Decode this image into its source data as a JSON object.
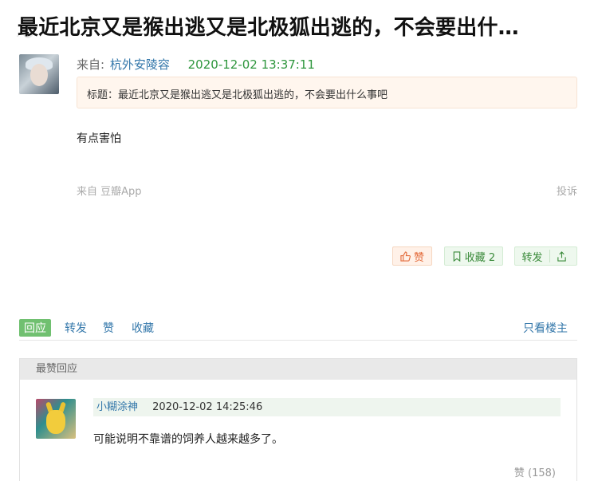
{
  "post": {
    "title": "最近北京又是猴出逃又是北极狐出逃的，不会要出什…",
    "from_label": "来自:",
    "author": "杭外安陵容",
    "timestamp": "2020-12-02 13:37:11",
    "quote": "标题：最近北京又是猴出逃又是北极狐出逃的，不会要出什么事吧",
    "body": "有点害怕",
    "source_app": "来自 豆瓣App",
    "report": "投诉"
  },
  "actions": {
    "like_label": "赞",
    "fav_label": "收藏 2",
    "share_label": "转发",
    "like_color": "#e36b3b",
    "green_color": "#3a8a3a"
  },
  "tabs": {
    "items": [
      "回应",
      "转发",
      "赞",
      "收藏"
    ],
    "only_host": "只看楼主"
  },
  "best_replies": {
    "header": "最赞回应",
    "reply": {
      "author": "小糊涂神",
      "timestamp": "2020-12-02 14:25:46",
      "text": "可能说明不靠谱的饲养人越来越多了。",
      "likes": "赞 (158)"
    }
  },
  "icons": [
    "thumbs-up-icon",
    "bookmark-icon",
    "share-out-icon"
  ]
}
